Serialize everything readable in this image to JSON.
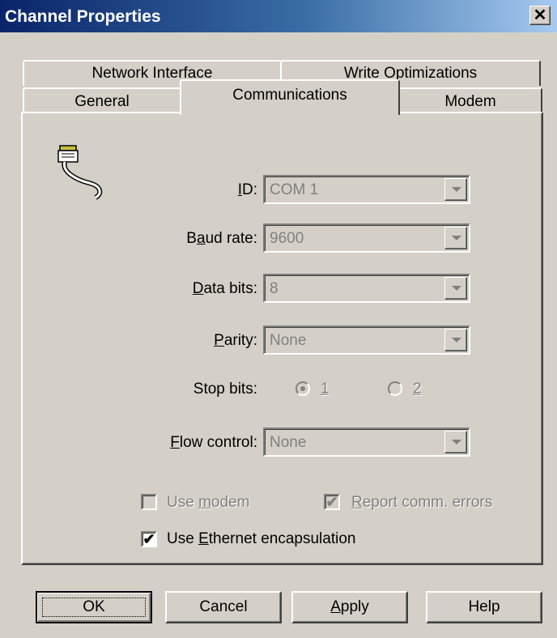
{
  "window": {
    "title": "Channel Properties",
    "close_glyph": "✕"
  },
  "tabs": {
    "row1": [
      {
        "label": "Network Interface"
      },
      {
        "label": "Write Optimizations"
      }
    ],
    "row2": [
      {
        "label": "General"
      },
      {
        "label": "Communications",
        "selected": true
      },
      {
        "label": "Modem"
      }
    ]
  },
  "panel": {
    "icon": "serial-cable-icon",
    "id": {
      "label_pre": "",
      "label_u": "I",
      "label_post": "D:",
      "value": "COM 1"
    },
    "baud_rate": {
      "label_pre": "B",
      "label_u": "a",
      "label_post": "ud rate:",
      "value": "9600"
    },
    "data_bits": {
      "label_pre": "",
      "label_u": "D",
      "label_post": "ata bits:",
      "value": "8"
    },
    "parity": {
      "label_pre": "",
      "label_u": "P",
      "label_post": "arity:",
      "value": "None"
    },
    "stop_bits": {
      "label": "Stop bits:",
      "option1": "1",
      "option2": "2",
      "selected": "1"
    },
    "flow_control": {
      "label_pre": "",
      "label_u": "F",
      "label_post": "low control:",
      "value": "None"
    },
    "use_modem": {
      "label_pre": "Use ",
      "label_u": "m",
      "label_post": "odem",
      "checked": false,
      "enabled": false
    },
    "report_errors": {
      "label_pre": "",
      "label_u": "R",
      "label_post": "eport comm. errors",
      "checked": true,
      "enabled": false
    },
    "ethernet": {
      "label_pre": "Use ",
      "label_u": "E",
      "label_post": "thernet encapsulation",
      "checked": true,
      "enabled": true
    }
  },
  "buttons": {
    "ok": "OK",
    "cancel": "Cancel",
    "apply_u": "A",
    "apply_rest": "pply",
    "help": "Help"
  },
  "colors": {
    "face": "#d4d0c8",
    "title_start": "#0a246a",
    "title_end": "#a6caf0",
    "disabled": "#808080"
  }
}
